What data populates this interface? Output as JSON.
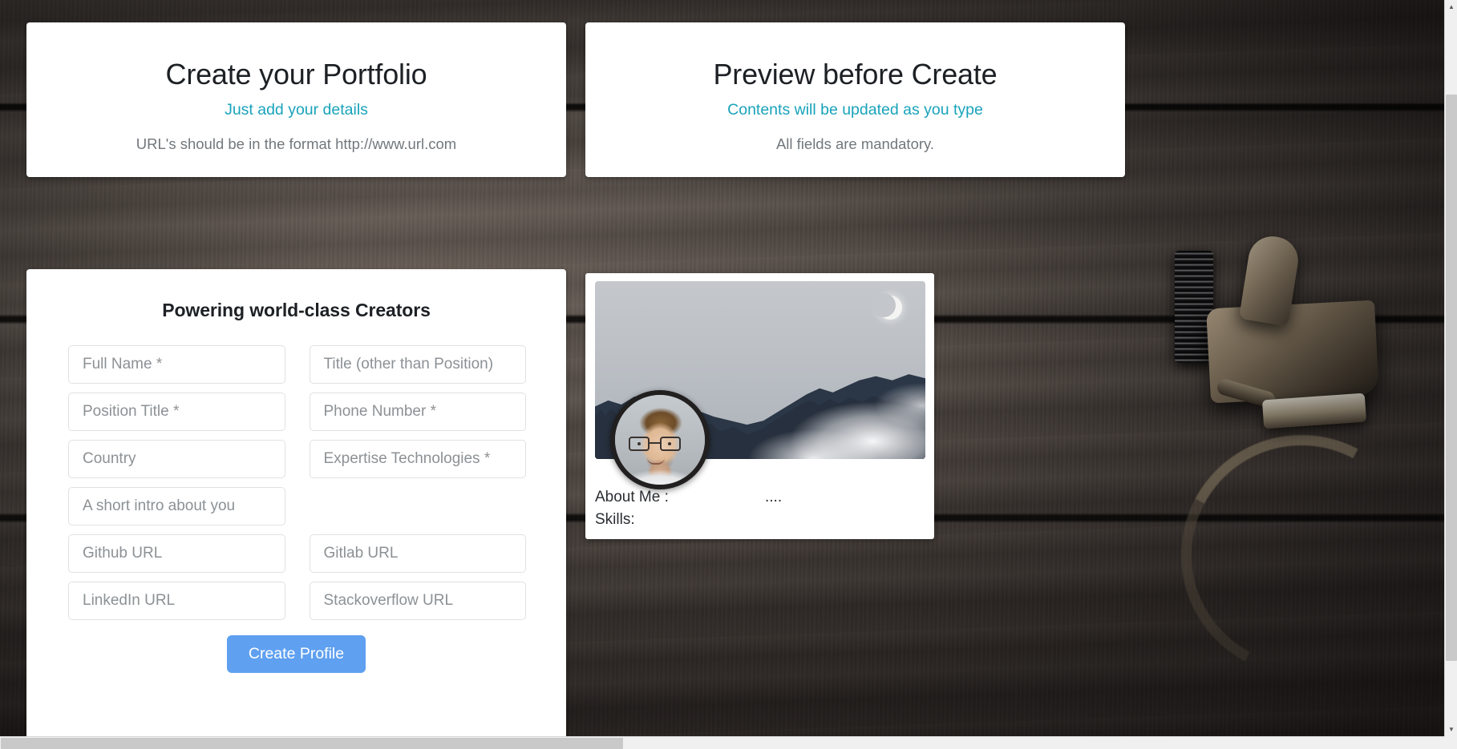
{
  "header_left": {
    "title": "Create your Portfolio",
    "subtitle": "Just add your details",
    "note": "URL's should be in the format http://www.url.com"
  },
  "header_right": {
    "title": "Preview before Create",
    "subtitle": "Contents will be updated as you type",
    "note": "All fields are mandatory."
  },
  "form": {
    "title": "Powering world-class Creators",
    "fields": [
      {
        "name": "full-name-input",
        "placeholder": "Full Name *",
        "value": ""
      },
      {
        "name": "title-input",
        "placeholder": "Title (other than Position)",
        "value": ""
      },
      {
        "name": "position-title-input",
        "placeholder": "Position Title *",
        "value": ""
      },
      {
        "name": "phone-number-input",
        "placeholder": "Phone Number *",
        "value": ""
      },
      {
        "name": "country-input",
        "placeholder": "Country",
        "value": ""
      },
      {
        "name": "expertise-technologies-input",
        "placeholder": "Expertise Technologies *",
        "value": ""
      },
      {
        "name": "short-intro-input",
        "placeholder": "A short intro about you",
        "value": ""
      },
      {
        "name": "github-url-input",
        "placeholder": "Github URL",
        "value": ""
      },
      {
        "name": "gitlab-url-input",
        "placeholder": "Gitlab URL",
        "value": ""
      },
      {
        "name": "linkedin-url-input",
        "placeholder": "LinkedIn URL",
        "value": ""
      },
      {
        "name": "stackoverflow-url-input",
        "placeholder": "Stackoverflow URL",
        "value": ""
      }
    ],
    "submit_label": "Create Profile"
  },
  "preview": {
    "cover_photo_alt": "mountain-forest-moon-cover-photo",
    "avatar_alt": "profile-avatar-photo",
    "about_me_label": "About Me :",
    "about_me_value": "....",
    "skills_label": "Skills:"
  },
  "scrollbars": {
    "up_arrow": "▲",
    "down_arrow": "▼"
  },
  "colors": {
    "accent_teal": "#19a3bb",
    "button_blue": "#5fa0f0",
    "card_white": "#ffffff",
    "note_gray": "#72777c",
    "heading_dark": "#1d2024",
    "placeholder_gray": "#8c9195",
    "field_border": "#dfe1e4"
  }
}
